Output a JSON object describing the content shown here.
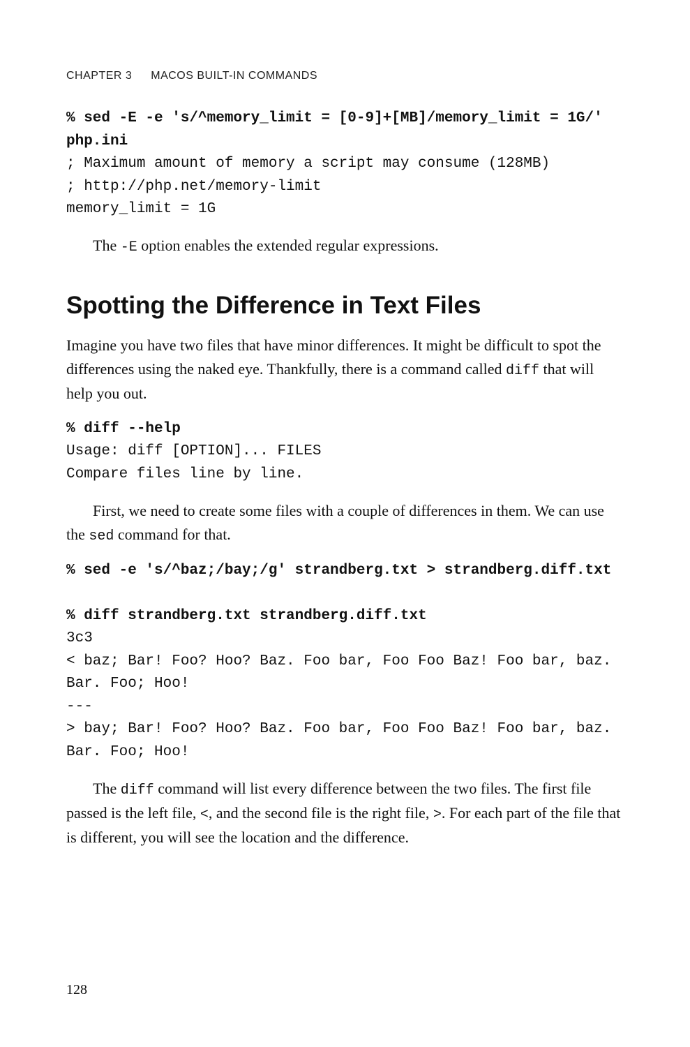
{
  "runningHead": {
    "chapter": "CHAPTER 3",
    "title": "MACOS BUILT-IN COMMANDS"
  },
  "block1": {
    "cmd": "% sed -E -e 's/^memory_limit = [0-9]+[MB]/memory_limit = 1G/' php.ini",
    "out": "; Maximum amount of memory a script may consume (128MB)\n; http://php.net/memory-limit\nmemory_limit = 1G"
  },
  "para1": {
    "pre": "The ",
    "code": "-E",
    "post": " option enables the extended regular expressions."
  },
  "sectionTitle": "Spotting the Difference in Text Files",
  "para2": {
    "pre": "Imagine you have two files that have minor differences. It might be difficult to spot the differences using the naked eye. Thankfully, there is a command called ",
    "code": "diff",
    "post": " that will help you out."
  },
  "block2": {
    "cmd": "% diff --help",
    "out": "Usage: diff [OPTION]... FILES\nCompare files line by line."
  },
  "para3": {
    "pre": "First, we need to create some files with a couple of differences in them. We can use the ",
    "code": "sed",
    "post": " command for that."
  },
  "block3": {
    "cmd1": "% sed -e 's/^baz;/bay;/g' strandberg.txt > strandberg.diff.txt",
    "cmd2": "% diff strandberg.txt strandberg.diff.txt",
    "out": "3c3\n< baz; Bar! Foo? Hoo? Baz. Foo bar, Foo Foo Baz! Foo bar, baz. Bar. Foo; Hoo!\n---\n> bay; Bar! Foo? Hoo? Baz. Foo bar, Foo Foo Baz! Foo bar, baz. Bar. Foo; Hoo!"
  },
  "para4": {
    "pre": "The ",
    "code1": "diff",
    "mid1": " command will list every difference between the two files. The first file passed is the left file, ",
    "code2": "<",
    "mid2": ", and the second file is the right file, ",
    "code3": ">",
    "post": ". For each part of the file that is different, you will see the location and the difference."
  },
  "pageNumber": "128"
}
